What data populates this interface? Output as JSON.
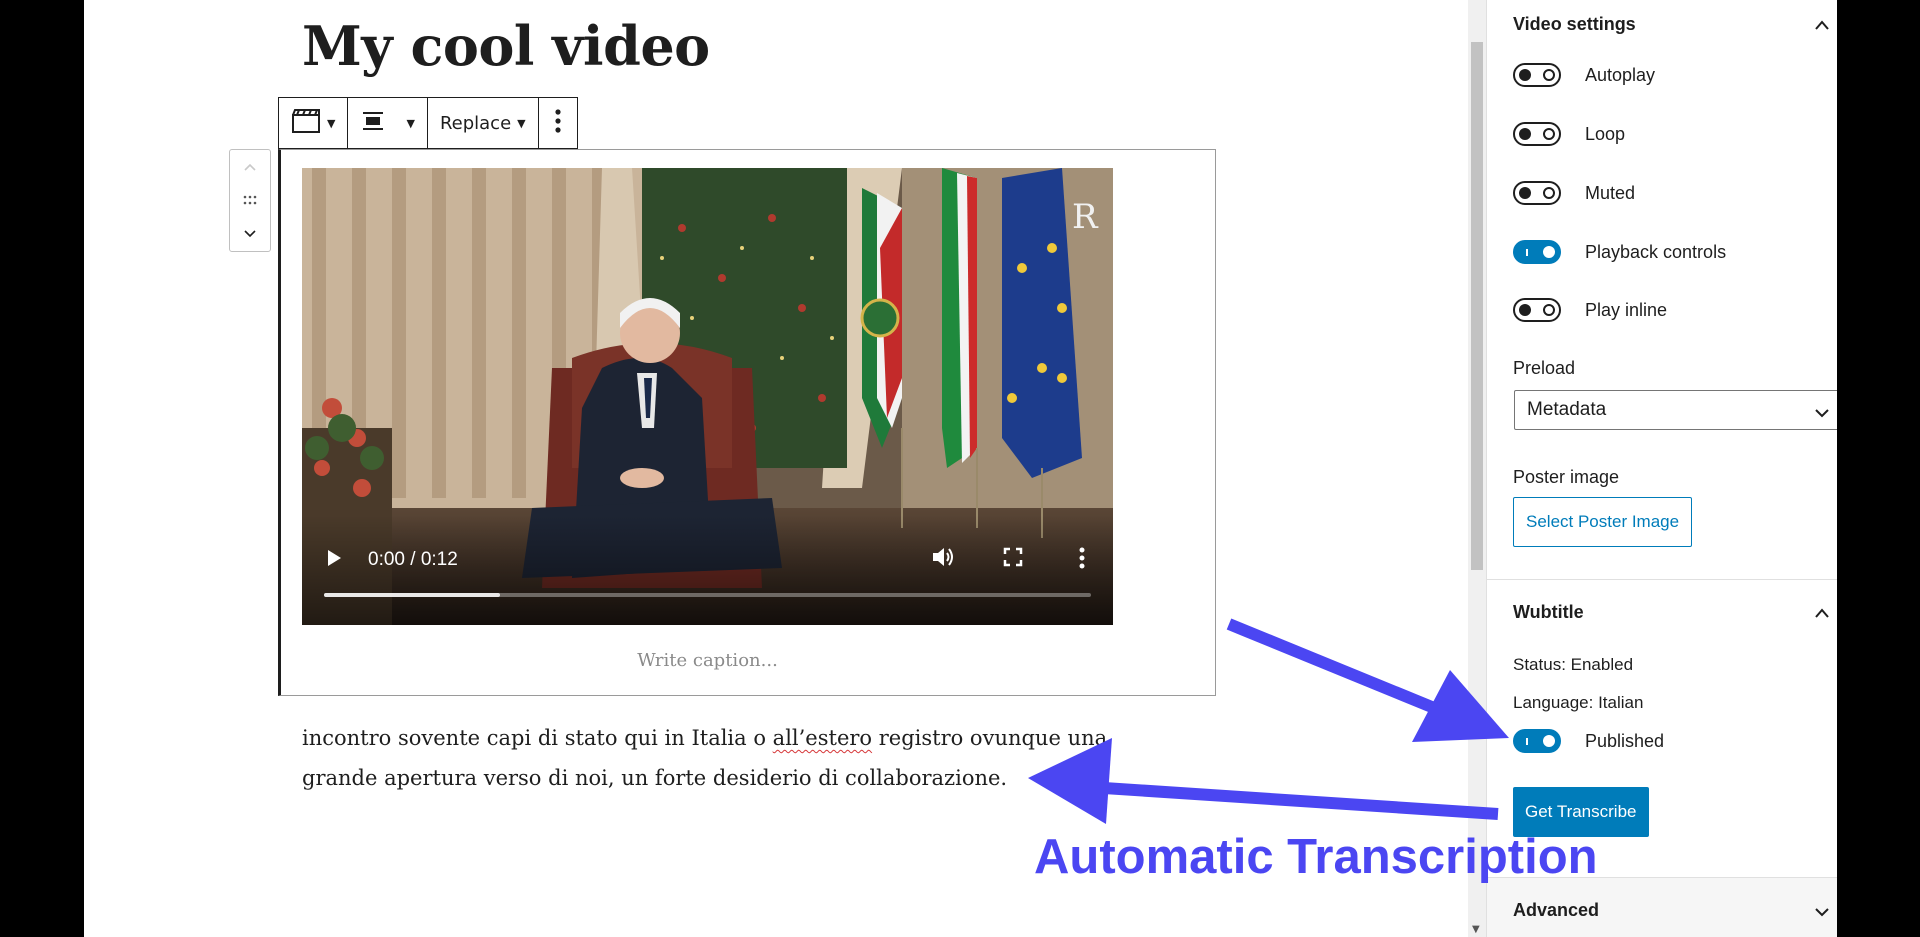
{
  "editor": {
    "post_title": "My cool video",
    "toolbar": {
      "replace_label": "Replace",
      "block_type_icon": "video-icon",
      "align_icon": "align-center-icon",
      "more_icon": "more-vertical-icon"
    },
    "video": {
      "time": "0:00 / 0:12",
      "progress_fraction": 0.23
    },
    "caption_placeholder": "Write caption...",
    "paragraph": {
      "before_misspelled": "incontro sovente capi di stato qui in Italia o ",
      "misspelled_word": "all’estero",
      "after_misspelled": " registro ovunque una grande apertura verso di noi, un forte desiderio di collaborazione."
    }
  },
  "sidebar": {
    "video_settings": {
      "title": "Video settings",
      "toggles": [
        {
          "label": "Autoplay",
          "on": false
        },
        {
          "label": "Loop",
          "on": false
        },
        {
          "label": "Muted",
          "on": false
        },
        {
          "label": "Playback controls",
          "on": true
        },
        {
          "label": "Play inline",
          "on": false
        }
      ],
      "preload_label": "Preload",
      "preload_value": "Metadata",
      "poster_label": "Poster image",
      "poster_button": "Select Poster Image"
    },
    "wubtitle": {
      "title": "Wubtitle",
      "status": "Status: Enabled",
      "language": "Language: Italian",
      "published_label": "Published",
      "published_on": true,
      "get_transcribe_button": "Get Transcribe"
    },
    "advanced": {
      "title": "Advanced"
    }
  },
  "annotation": {
    "text": "Automatic Transcription",
    "color": "#4b46f2"
  },
  "colors": {
    "accent": "#007cba",
    "text": "#1e1e1e",
    "annotation": "#4b46f2"
  }
}
